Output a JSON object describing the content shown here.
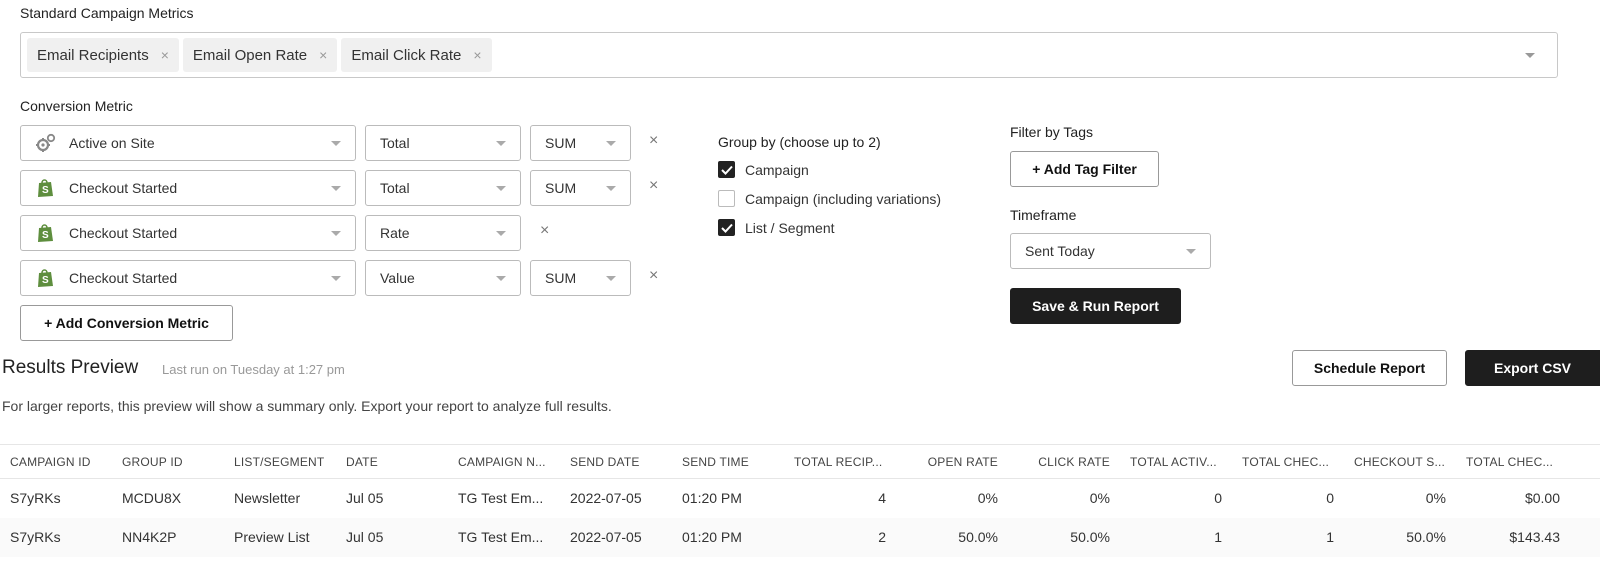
{
  "standard": {
    "label": "Standard Campaign Metrics",
    "chips": [
      "Email Recipients",
      "Email Open Rate",
      "Email Click Rate"
    ],
    "chip_close": "×"
  },
  "conversion": {
    "label": "Conversion Metric",
    "rows": [
      {
        "metric": "Active on Site",
        "icon": "gears-icon",
        "type": "Total",
        "agg": "SUM"
      },
      {
        "metric": "Checkout Started",
        "icon": "shopify-icon",
        "type": "Total",
        "agg": "SUM"
      },
      {
        "metric": "Checkout Started",
        "icon": "shopify-icon",
        "type": "Rate",
        "agg": null
      },
      {
        "metric": "Checkout Started",
        "icon": "shopify-icon",
        "type": "Value",
        "agg": "SUM"
      }
    ],
    "remove": "×",
    "add_button": "+ Add Conversion Metric"
  },
  "groupby": {
    "label": "Group by (choose up to 2)",
    "options": [
      {
        "label": "Campaign",
        "checked": true
      },
      {
        "label": "Campaign (including variations)",
        "checked": false
      },
      {
        "label": "List / Segment",
        "checked": true
      }
    ]
  },
  "filter": {
    "label": "Filter by Tags",
    "add_button": "+ Add Tag Filter"
  },
  "timeframe": {
    "label": "Timeframe",
    "value": "Sent Today"
  },
  "save_button": "Save & Run Report",
  "results": {
    "title": "Results Preview",
    "last_run": "Last run on Tuesday at 1:27 pm",
    "note": "For larger reports, this preview will show a summary only. Export your report to analyze full results.",
    "schedule_button": "Schedule Report",
    "export_button": "Export CSV"
  },
  "table": {
    "columns": [
      "CAMPAIGN ID",
      "GROUP ID",
      "LIST/SEGMENT",
      "DATE",
      "CAMPAIGN N...",
      "SEND DATE",
      "SEND TIME",
      "TOTAL RECIP...",
      "OPEN RATE",
      "CLICK RATE",
      "TOTAL ACTIV...",
      "TOTAL CHEC...",
      "CHECKOUT S...",
      "TOTAL CHEC..."
    ],
    "rows": [
      [
        "S7yRKs",
        "MCDU8X",
        "Newsletter",
        "Jul 05",
        "TG Test Em...",
        "2022-07-05",
        "01:20 PM",
        "4",
        "0%",
        "0%",
        "0",
        "0",
        "0%",
        "$0.00"
      ],
      [
        "S7yRKs",
        "NN4K2P",
        "Preview List",
        "Jul 05",
        "TG Test Em...",
        "2022-07-05",
        "01:20 PM",
        "2",
        "50.0%",
        "50.0%",
        "1",
        "1",
        "50.0%",
        "$143.43"
      ]
    ]
  },
  "colors": {
    "accent_dark": "#1e1e1e",
    "shopify_green": "#5e8e3e"
  }
}
